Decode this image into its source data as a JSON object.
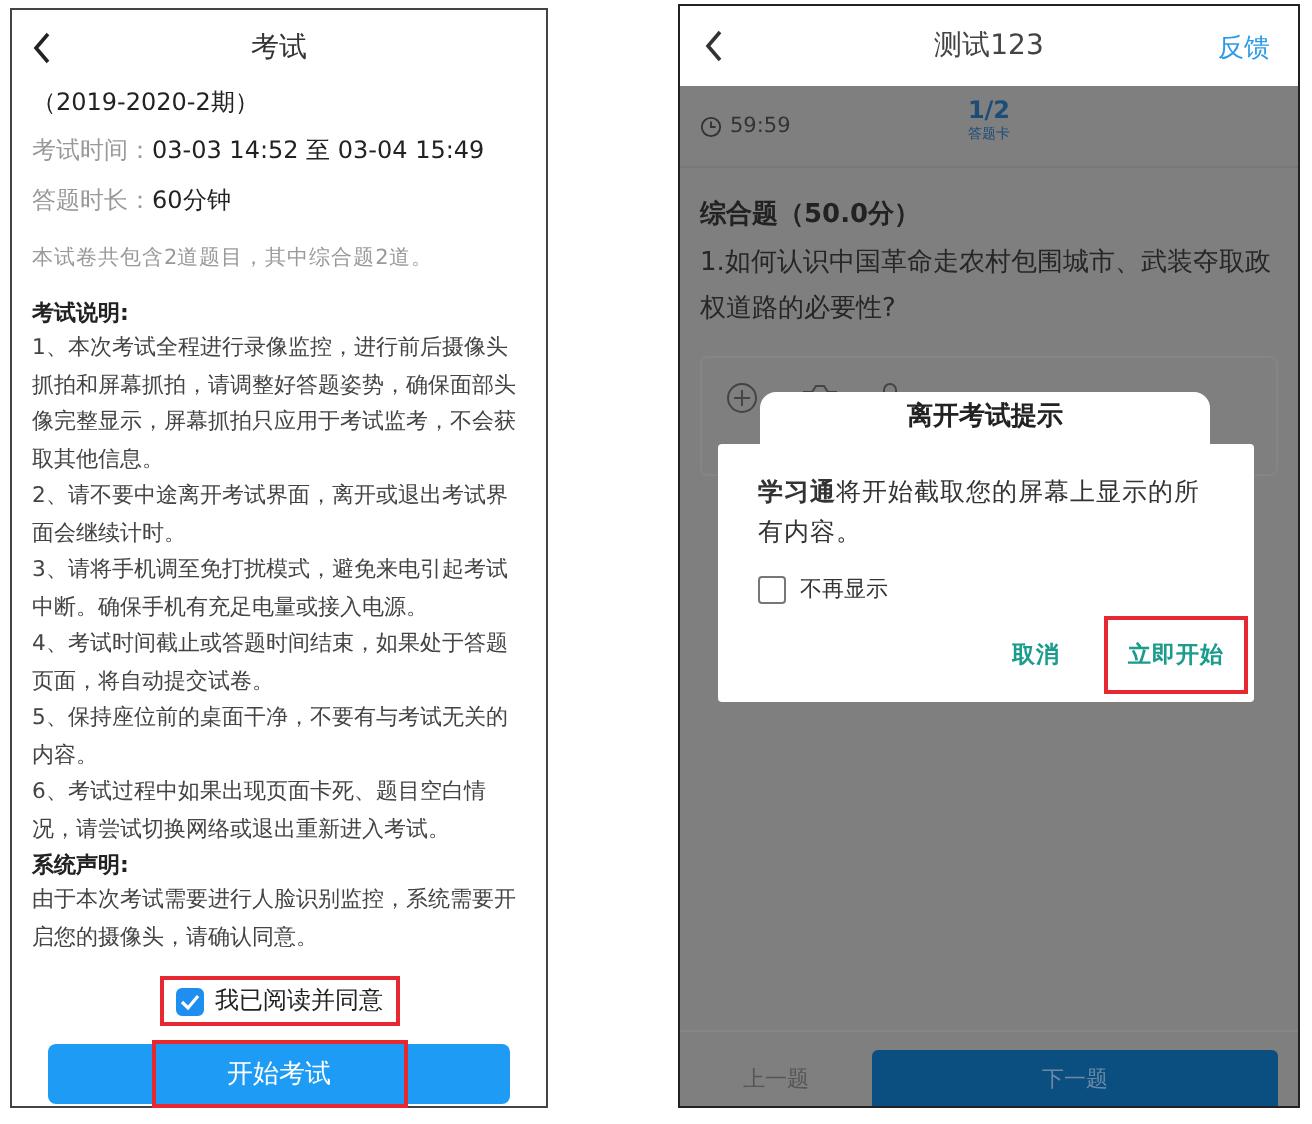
{
  "exam_info_screen": {
    "header": {
      "title": "考试"
    },
    "term": "（2019-2020-2期）",
    "info_rows": [
      {
        "label": "考试时间：",
        "value": "03-03 14:52 至 03-04 15:49"
      },
      {
        "label": "答题时长：",
        "value": "60分钟"
      }
    ],
    "summary": "本试卷共包含2道题目，其中综合题2道。",
    "sections": [
      {
        "heading": "考试说明:",
        "paragraphs": [
          "1、本次考试全程进行录像监控，进行前后摄像头抓拍和屏幕抓拍，请调整好答题姿势，确保面部头像完整显示，屏幕抓拍只应用于考试监考，不会获取其他信息。",
          "2、请不要中途离开考试界面，离开或退出考试界面会继续计时。",
          "3、请将手机调至免打扰模式，避免来电引起考试中断。确保手机有充足电量或接入电源。",
          "4、考试时间截止或答题时间结束，如果处于答题页面，将自动提交试卷。",
          "5、保持座位前的桌面干净，不要有与考试无关的内容。",
          "6、考试过程中如果出现页面卡死、题目空白情况，请尝试切换网络或退出重新进入考试。"
        ]
      },
      {
        "heading": "系统声明:",
        "paragraphs": [
          "由于本次考试需要进行人脸识别监控，系统需要开启您的摄像头，请确认同意。"
        ]
      }
    ],
    "agree": {
      "label": "我已阅读并同意",
      "checked": true,
      "highlighted": true
    },
    "start_button": {
      "label": "开始考试",
      "highlighted": true
    }
  },
  "exam_screen": {
    "header": {
      "title": "测试123",
      "action": "反馈"
    },
    "timer": "59:59",
    "progress": "1/2",
    "answer_card": "答题卡",
    "question_type": "综合题（50.0分）",
    "question": "1.如何认识中国革命走农村包围城市、武装夺取政权道路的必要性?",
    "nav": {
      "previous": "上一题",
      "next": "下一题"
    },
    "background_dialog": {
      "title": "离开考试提示"
    },
    "dialog": {
      "message": "**学习通**将开始截取您的屏幕上显示的所有内容。",
      "checkbox": {
        "label": "不再显示",
        "checked": false
      },
      "buttons": [
        {
          "label": "取消",
          "highlighted": false
        },
        {
          "label": "立即开始",
          "highlighted": true
        }
      ]
    }
  }
}
